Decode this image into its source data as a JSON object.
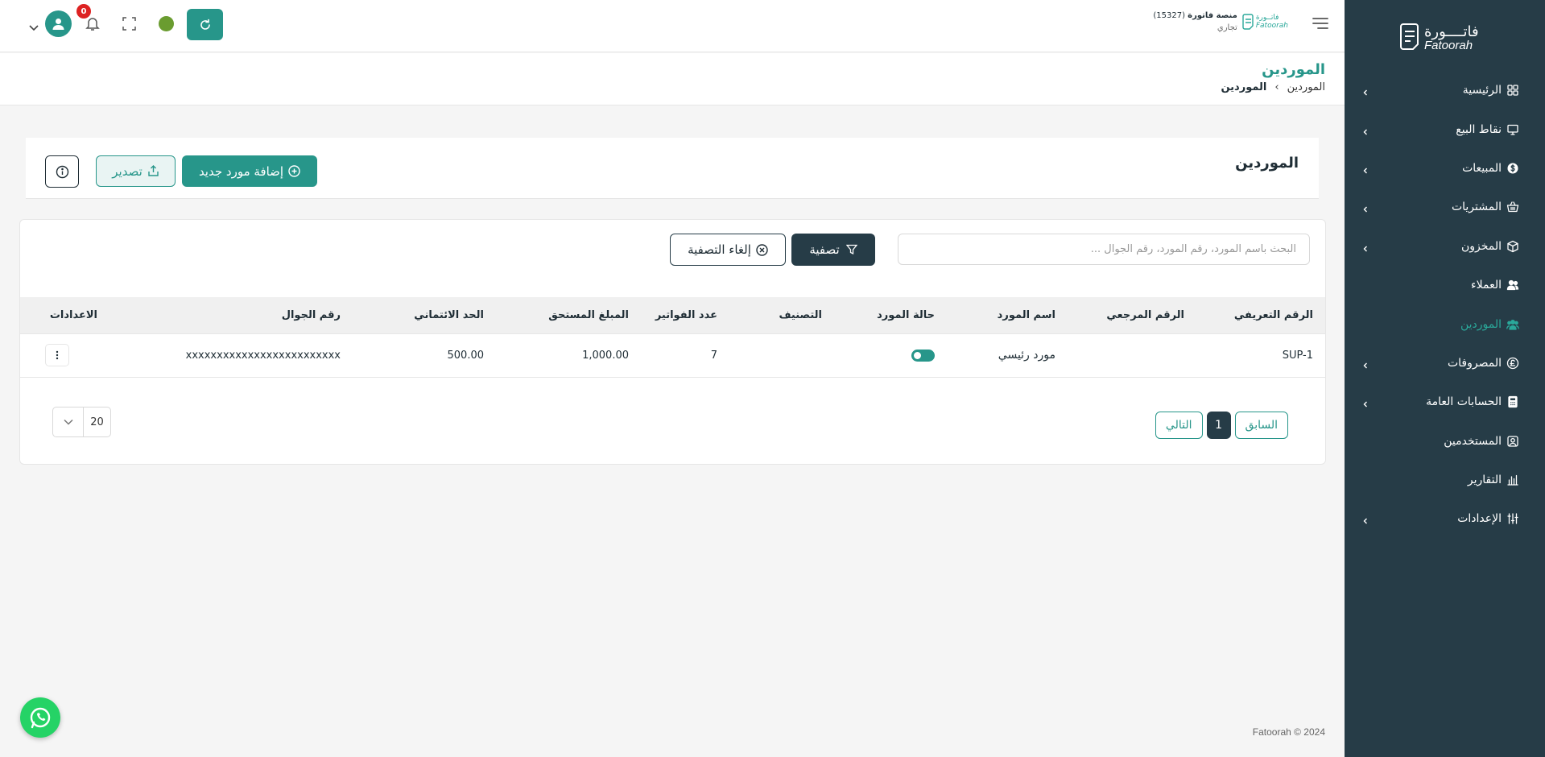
{
  "brand": {
    "name_ar": "فاتــــورة",
    "name_en": "Fatoorah"
  },
  "sidebar": {
    "items": [
      {
        "label": "الرئيسية",
        "icon": "grid-icon",
        "has_chevron": true
      },
      {
        "label": "نقاط البيع",
        "icon": "monitor-icon",
        "has_chevron": true
      },
      {
        "label": "المبيعات",
        "icon": "dollar-icon",
        "has_chevron": true
      },
      {
        "label": "المشتريات",
        "icon": "basket-icon",
        "has_chevron": true
      },
      {
        "label": "المخزون",
        "icon": "box-icon",
        "has_chevron": true
      },
      {
        "label": "العملاء",
        "icon": "users-icon",
        "has_chevron": false
      },
      {
        "label": "الموردين",
        "icon": "group-icon",
        "has_chevron": false,
        "active": true
      },
      {
        "label": "المصروفات",
        "icon": "pound-icon",
        "has_chevron": true
      },
      {
        "label": "الحسابات العامة",
        "icon": "calculator-icon",
        "has_chevron": true
      },
      {
        "label": "المستخدمين",
        "icon": "user-square-icon",
        "has_chevron": false
      },
      {
        "label": "التقارير",
        "icon": "chart-icon",
        "has_chevron": false
      },
      {
        "label": "الإعدادات",
        "icon": "sliders-icon",
        "has_chevron": true
      }
    ]
  },
  "header": {
    "platform_name": "منصة فاتورة",
    "platform_id": "(15327)",
    "platform_type": "تجاري",
    "mini_logo_ar": "فاتــورة",
    "mini_logo_en": "Fatoorah",
    "notifications_count": "0"
  },
  "breadcrumb": {
    "title": "الموردين",
    "root": "الموردين",
    "current": "الموردين"
  },
  "card": {
    "title": "الموردين",
    "add_button": "إضافة مورد جديد",
    "export_button": "تصدير"
  },
  "filters": {
    "search_placeholder": "البحث باسم المورد، رقم المورد، رقم الجوال ...",
    "filter_button": "تصفية",
    "clear_button": "إلغاء التصفية"
  },
  "table": {
    "headers": [
      "الرقم التعريفي",
      "الرقم المرجعي",
      "اسم المورد",
      "حالة المورد",
      "التصنيف",
      "عدد الفواتير",
      "المبلغ المستحق",
      "الحد الائتماني",
      "رقم الجوال",
      "الاعدادات"
    ],
    "rows": [
      {
        "id": "SUP-1",
        "ref": "",
        "name": "مورد رئيسي",
        "status": "active",
        "category": "",
        "invoices": "7",
        "due": "1,000.00",
        "credit": "500.00",
        "mobile": "xxxxxxxxxxxxxxxxxxxxxxxxx"
      }
    ]
  },
  "pagination": {
    "prev": "السابق",
    "current": "1",
    "next": "التالي",
    "per_page": "20"
  },
  "footer": {
    "copyright": "Fatoorah © 2024"
  },
  "colors": {
    "sidebar": "#263c47",
    "primary": "#27968a",
    "dark": "#263c47",
    "danger": "#dd2222"
  }
}
